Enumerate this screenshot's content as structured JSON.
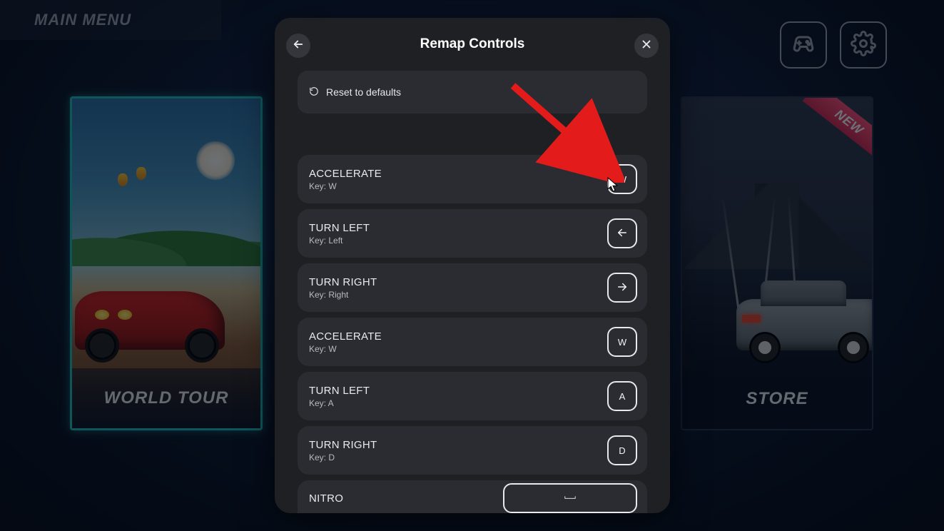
{
  "header": {
    "main_menu_label": "MAIN MENU"
  },
  "cards": {
    "left_caption": "WORLD TOUR",
    "right_caption": "STORE",
    "ribbon": "NEW"
  },
  "modal": {
    "title": "Remap Controls",
    "reset_label": "Reset to defaults",
    "rows": [
      {
        "name": "ACCELERATE",
        "key_label": "Key: W",
        "cap": "W",
        "cap_type": "text"
      },
      {
        "name": "TURN LEFT",
        "key_label": "Key: Left",
        "cap": "left",
        "cap_type": "arrow"
      },
      {
        "name": "TURN RIGHT",
        "key_label": "Key: Right",
        "cap": "right",
        "cap_type": "arrow"
      },
      {
        "name": "ACCELERATE",
        "key_label": "Key: W",
        "cap": "W",
        "cap_type": "text"
      },
      {
        "name": "TURN LEFT",
        "key_label": "Key: A",
        "cap": "A",
        "cap_type": "text"
      },
      {
        "name": "TURN RIGHT",
        "key_label": "Key: D",
        "cap": "D",
        "cap_type": "text"
      }
    ],
    "partial_row": {
      "name": "NITRO",
      "cap_type": "space"
    }
  }
}
